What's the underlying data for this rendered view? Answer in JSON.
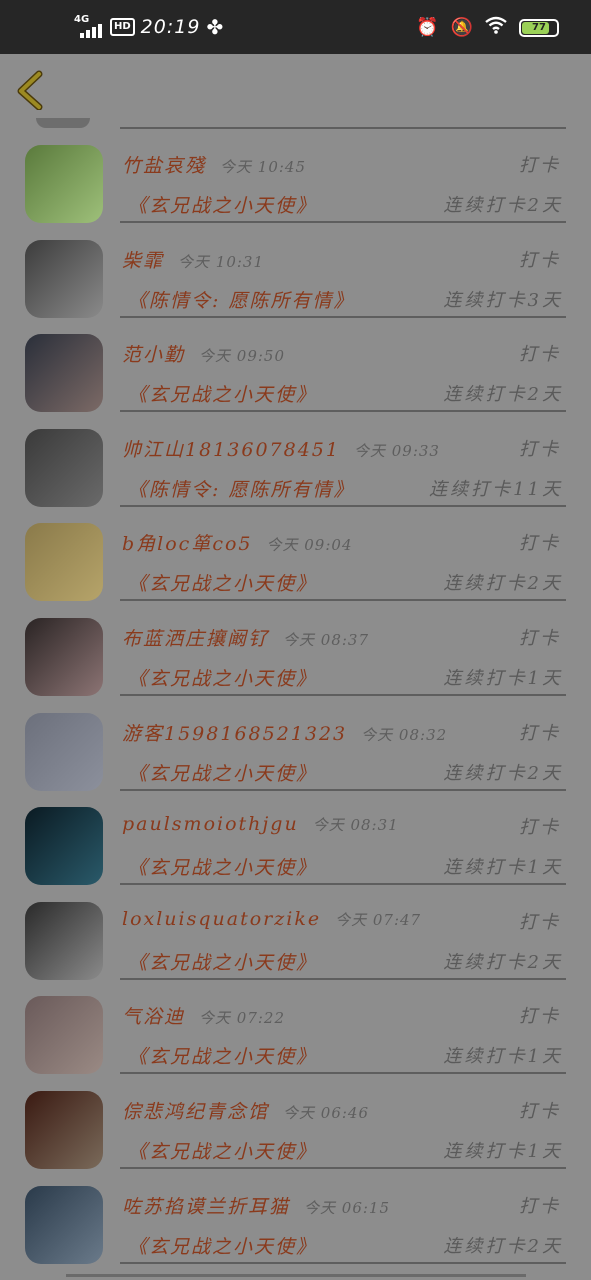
{
  "status_bar": {
    "network": "4G",
    "hd": "HD",
    "time": "20:19",
    "battery": "77"
  },
  "header": {
    "back_icon": "chevron-left-icon"
  },
  "rows": [
    {
      "name": "竹盐哀殘",
      "time": "今天 10:45",
      "punch": "打卡",
      "drama": "《玄兄战之小天使》",
      "streak": "连续打卡2天",
      "avatar_colors": [
        "#5a7a3c",
        "#9ec07a"
      ]
    },
    {
      "name": "柴霏",
      "time": "今天 10:31",
      "punch": "打卡",
      "drama": "《陈情令: 愿陈所有情》",
      "streak": "连续打卡3天",
      "avatar_colors": [
        "#3c3c3c",
        "#8a8a8a"
      ]
    },
    {
      "name": "范小勤",
      "time": "今天 09:50",
      "punch": "打卡",
      "drama": "《玄兄战之小天使》",
      "streak": "连续打卡2天",
      "avatar_colors": [
        "#2a2f3a",
        "#7c6a66"
      ]
    },
    {
      "name": "帅江山18136078451",
      "time": "今天 09:33",
      "punch": "打卡",
      "drama": "《陈情令: 愿陈所有情》",
      "streak": "连续打卡11天",
      "avatar_colors": [
        "#3a3a3a",
        "#6a6a6a"
      ]
    },
    {
      "name": "b角loc箪co5",
      "time": "今天 09:04",
      "punch": "打卡",
      "drama": "《玄兄战之小天使》",
      "streak": "连续打卡2天",
      "avatar_colors": [
        "#8a7a4a",
        "#b6a46a"
      ]
    },
    {
      "name": "布蓝洒庄攘阚钌",
      "time": "今天 08:37",
      "punch": "打卡",
      "drama": "《玄兄战之小天使》",
      "streak": "连续打卡1天",
      "avatar_colors": [
        "#2a2424",
        "#8c7474"
      ]
    },
    {
      "name": "游客15981685213​23",
      "time": "今天 08:32",
      "punch": "打卡",
      "drama": "《玄兄战之小天使》",
      "streak": "连续打卡2天",
      "avatar_colors": [
        "#6c707c",
        "#8c909c"
      ]
    },
    {
      "name": "paulsmoiothjgu",
      "time": "今天 08:31",
      "punch": "打卡",
      "drama": "《玄兄战之小天使》",
      "streak": "连续打卡1天",
      "avatar_colors": [
        "#0a1a22",
        "#2a5a6a"
      ]
    },
    {
      "name": "loxluisquatorzike",
      "time": "今天 07:47",
      "punch": "打卡",
      "drama": "《玄兄战之小天使》",
      "streak": "连续打卡2天",
      "avatar_colors": [
        "#2a2a2a",
        "#8a8a8a"
      ]
    },
    {
      "name": "气浴迪",
      "time": "今天 07:22",
      "punch": "打卡",
      "drama": "《玄兄战之小天使》",
      "streak": "连续打卡1天",
      "avatar_colors": [
        "#6a5a5a",
        "#9a8a84"
      ]
    },
    {
      "name": "倧悲鸿纪青念馆",
      "time": "今天 06:46",
      "punch": "打卡",
      "drama": "《玄兄战之小天使》",
      "streak": "连续打卡1天",
      "avatar_colors": [
        "#3a1a12",
        "#7a6a5a"
      ]
    },
    {
      "name": "咗苏掐谟兰折耳猫",
      "time": "今天 06:15",
      "punch": "打卡",
      "drama": "《玄兄战之小天使》",
      "streak": "连续打卡2天",
      "avatar_colors": [
        "#2a3a4a",
        "#6a7a8a"
      ]
    }
  ]
}
